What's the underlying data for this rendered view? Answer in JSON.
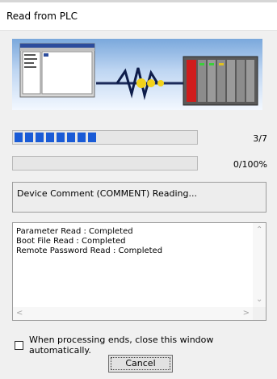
{
  "window": {
    "title": "Read from PLC"
  },
  "progress": {
    "step_text": "3/7",
    "step_filled_segments": 8,
    "percent_text": "0/100%",
    "percent_value": 0
  },
  "status": {
    "text": "Device Comment (COMMENT) Reading..."
  },
  "log": {
    "lines": [
      "Parameter Read : Completed",
      "Boot File Read : Completed",
      "Remote Password Read : Completed"
    ]
  },
  "options": {
    "auto_close_label": "When processing ends, close this window automatically.",
    "auto_close_checked": false
  },
  "buttons": {
    "cancel_label": "Cancel"
  },
  "colors": {
    "progress": "#1a5bd6",
    "banner_top": "#7aa8dc"
  }
}
